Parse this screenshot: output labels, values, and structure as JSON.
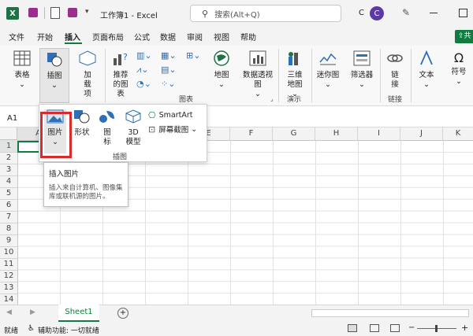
{
  "titlebar": {
    "doc_title": "工作簿1 - Excel",
    "search_placeholder": "搜索(Alt+Q)",
    "user_initial": "C",
    "user_extra": "C"
  },
  "menu": {
    "tabs": [
      "文件",
      "开始",
      "插入",
      "页面布局",
      "公式",
      "数据",
      "审阅",
      "视图",
      "帮助"
    ],
    "active": "插入",
    "share_label": "共"
  },
  "ribbon": {
    "table_label": "表格",
    "picture_label": "插图",
    "addin_label": "加载项",
    "recommended_chart_label": "推荐的图表",
    "map_label": "地图",
    "pivot_chart_label": "数据透视图",
    "three_d_map_label": "三维地图",
    "sparkline_label": "迷你图",
    "filter_label": "筛选器",
    "link_label": "链接",
    "text_label": "文本",
    "symbol_label": "符号",
    "group_chart": "图表",
    "group_tour": "演示",
    "group_links": "链接"
  },
  "dropdown": {
    "picture_label": "图片",
    "shapes_label": "形状",
    "icons_label": "图标",
    "model_label": "3D 模型",
    "smartart_label": "SmartArt",
    "screenshot_label": "屏幕截图",
    "group_label": "插图"
  },
  "tooltip": {
    "title": "插入图片",
    "body": "插入来自计算机、图像集库或联机源的图片。"
  },
  "namebox": {
    "value": "A1"
  },
  "columns": [
    "A",
    "B",
    "C",
    "D",
    "E",
    "F",
    "G",
    "H",
    "I",
    "J",
    "K"
  ],
  "rows": [
    "1",
    "2",
    "3",
    "4",
    "5",
    "6",
    "7",
    "8",
    "9",
    "10",
    "11",
    "12",
    "13",
    "14",
    "15"
  ],
  "sheets": {
    "active": "Sheet1"
  },
  "status": {
    "ready": "就绪",
    "accessibility": "辅助功能: 一切就绪"
  },
  "colors": {
    "accent": "#107c41",
    "highlight": "#d92b2b"
  }
}
